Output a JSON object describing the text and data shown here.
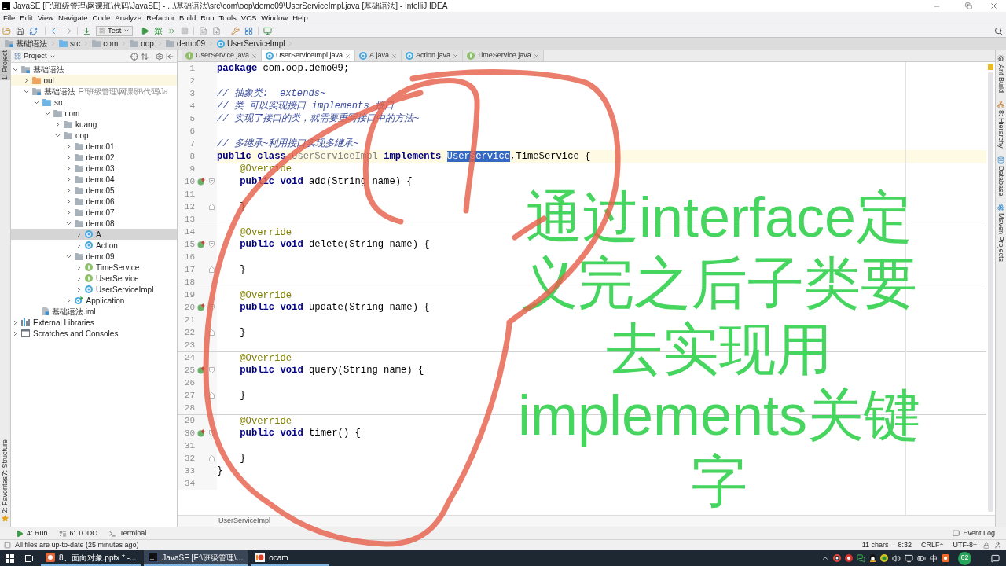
{
  "window": {
    "title": "JavaSE [F:\\班级管理\\网课班\\代码\\JavaSE] - ...\\基础语法\\src\\com\\oop\\demo09\\UserServiceImpl.java [基础语法] - IntelliJ IDEA"
  },
  "menu": [
    "File",
    "Edit",
    "View",
    "Navigate",
    "Code",
    "Analyze",
    "Refactor",
    "Build",
    "Run",
    "Tools",
    "VCS",
    "Window",
    "Help"
  ],
  "toolbar": {
    "run_config": "Test"
  },
  "nav_bar": [
    {
      "label": "基础语法",
      "kind": "module"
    },
    {
      "label": "src",
      "kind": "source-folder"
    },
    {
      "label": "com",
      "kind": "package"
    },
    {
      "label": "oop",
      "kind": "package"
    },
    {
      "label": "demo09",
      "kind": "package"
    },
    {
      "label": "UserServiceImpl",
      "kind": "class"
    }
  ],
  "left_strip": [
    {
      "label": "1: Project",
      "selected": true
    },
    {
      "label": "7: Structure",
      "selected": false
    },
    {
      "label": "2: Favorites",
      "selected": false
    }
  ],
  "project_panel": {
    "title": "Project",
    "tree": [
      {
        "label": "基础语法",
        "kind": "module",
        "expanded": true,
        "selected": false,
        "children": [
          {
            "label": "out",
            "kind": "excluded-folder",
            "expanded": false,
            "selected": false
          },
          {
            "label": "基础语法",
            "path_hint": "F:\\班级管理\\网课班\\代码\\Ja",
            "kind": "module",
            "expanded": true,
            "selected": false,
            "children": [
              {
                "label": "src",
                "kind": "source-folder",
                "expanded": true,
                "selected": false,
                "children": [
                  {
                    "label": "com",
                    "kind": "package",
                    "expanded": true,
                    "selected": false,
                    "children": [
                      {
                        "label": "kuang",
                        "kind": "package",
                        "expanded": false,
                        "selected": false
                      },
                      {
                        "label": "oop",
                        "kind": "package",
                        "expanded": true,
                        "selected": false,
                        "children": [
                          {
                            "label": "demo01",
                            "kind": "package",
                            "expanded": false,
                            "selected": false
                          },
                          {
                            "label": "demo02",
                            "kind": "package",
                            "expanded": false,
                            "selected": false
                          },
                          {
                            "label": "demo03",
                            "kind": "package",
                            "expanded": false,
                            "selected": false
                          },
                          {
                            "label": "demo04",
                            "kind": "package",
                            "expanded": false,
                            "selected": false
                          },
                          {
                            "label": "demo05",
                            "kind": "package",
                            "expanded": false,
                            "selected": false
                          },
                          {
                            "label": "demo06",
                            "kind": "package",
                            "expanded": false,
                            "selected": false
                          },
                          {
                            "label": "demo07",
                            "kind": "package",
                            "expanded": false,
                            "selected": false
                          },
                          {
                            "label": "demo08",
                            "kind": "package",
                            "expanded": true,
                            "selected": false,
                            "children": [
                              {
                                "label": "A",
                                "kind": "class",
                                "expanded": false,
                                "selected": true
                              },
                              {
                                "label": "Action",
                                "kind": "class",
                                "expanded": false,
                                "selected": false
                              }
                            ]
                          },
                          {
                            "label": "demo09",
                            "kind": "package",
                            "expanded": true,
                            "selected": false,
                            "children": [
                              {
                                "label": "TimeService",
                                "kind": "interface",
                                "expanded": false,
                                "selected": false
                              },
                              {
                                "label": "UserService",
                                "kind": "interface",
                                "expanded": false,
                                "selected": false
                              },
                              {
                                "label": "UserServiceImpl",
                                "kind": "class",
                                "expanded": false,
                                "selected": false
                              }
                            ]
                          },
                          {
                            "label": "Application",
                            "kind": "app-class",
                            "expanded": false,
                            "selected": false
                          }
                        ]
                      }
                    ]
                  }
                ]
              },
              {
                "label": "基础语法.iml",
                "kind": "iml",
                "selected": false
              }
            ]
          }
        ]
      },
      {
        "label": "External Libraries",
        "kind": "libraries",
        "expanded": false,
        "selected": false
      },
      {
        "label": "Scratches and Consoles",
        "kind": "scratches",
        "expanded": false,
        "selected": false
      }
    ]
  },
  "editor": {
    "tabs": [
      {
        "label": "UserService.java",
        "kind": "interface",
        "selected": false
      },
      {
        "label": "UserServiceImpl.java",
        "kind": "class",
        "selected": true
      },
      {
        "label": "A.java",
        "kind": "class",
        "selected": false
      },
      {
        "label": "Action.java",
        "kind": "class",
        "selected": false
      },
      {
        "label": "TimeService.java",
        "kind": "interface",
        "selected": false
      }
    ],
    "lines": [
      {
        "n": "1",
        "current": false,
        "separator": false,
        "tokens": [
          {
            "kind": "keyword",
            "text": "package"
          },
          {
            "kind": "plain",
            "text": " com.oop.demo09;"
          }
        ]
      },
      {
        "n": "2",
        "current": false,
        "separator": false
      },
      {
        "n": "3",
        "current": false,
        "separator": false,
        "tokens": [
          {
            "kind": "comment",
            "text": "// 抽象类:  extends~"
          }
        ]
      },
      {
        "n": "4",
        "current": false,
        "separator": false,
        "tokens": [
          {
            "kind": "comment",
            "text": "// 类 可以实现接口 implements 接口"
          }
        ]
      },
      {
        "n": "5",
        "current": false,
        "separator": false,
        "tokens": [
          {
            "kind": "comment",
            "text": "// 实现了接口的类，就需要重写接口中的方法~"
          }
        ]
      },
      {
        "n": "6",
        "current": false,
        "separator": false
      },
      {
        "n": "7",
        "current": false,
        "separator": false,
        "tokens": [
          {
            "kind": "comment",
            "text": "// 多继承~利用接口实现多继承~"
          }
        ]
      },
      {
        "n": "8",
        "current": true,
        "separator": false,
        "tokens": [
          {
            "kind": "keyword",
            "text": "public"
          },
          {
            "kind": "keyword",
            "text": " class"
          },
          {
            "kind": "unused",
            "text": " UserServiceImpl"
          },
          {
            "kind": "keyword",
            "text": " implements "
          },
          {
            "kind": "selection",
            "text": "UserService"
          },
          {
            "kind": "plain",
            "text": ",TimeService {"
          }
        ]
      },
      {
        "n": "9",
        "current": false,
        "separator": false,
        "tokens": [
          {
            "kind": "annotation",
            "text": "    @Override"
          }
        ]
      },
      {
        "n": "10",
        "current": false,
        "separator": false,
        "gutter_icons": [
          {
            "kind": "implements"
          },
          {
            "kind": "fold-start"
          }
        ],
        "tokens": [
          {
            "kind": "keyword",
            "text": "    public"
          },
          {
            "kind": "keyword",
            "text": " void"
          },
          {
            "kind": "plain",
            "text": " add(String name) {"
          }
        ]
      },
      {
        "n": "11",
        "current": false,
        "separator": false
      },
      {
        "n": "12",
        "current": false,
        "separator": false,
        "gutter_icons": [
          {
            "kind": "fold-end"
          }
        ],
        "tokens": [
          {
            "kind": "plain",
            "text": "    }"
          }
        ]
      },
      {
        "n": "13",
        "current": false,
        "separator": false
      },
      {
        "n": "14",
        "current": false,
        "separator": true,
        "tokens": [
          {
            "kind": "annotation",
            "text": "    @Override"
          }
        ]
      },
      {
        "n": "15",
        "current": false,
        "separator": false,
        "gutter_icons": [
          {
            "kind": "implements"
          },
          {
            "kind": "fold-start"
          }
        ],
        "tokens": [
          {
            "kind": "keyword",
            "text": "    public"
          },
          {
            "kind": "keyword",
            "text": " void"
          },
          {
            "kind": "plain",
            "text": " delete(String name) {"
          }
        ]
      },
      {
        "n": "16",
        "current": false,
        "separator": false
      },
      {
        "n": "17",
        "current": false,
        "separator": false,
        "gutter_icons": [
          {
            "kind": "fold-end"
          }
        ],
        "tokens": [
          {
            "kind": "plain",
            "text": "    }"
          }
        ]
      },
      {
        "n": "18",
        "current": false,
        "separator": false
      },
      {
        "n": "19",
        "current": false,
        "separator": true,
        "tokens": [
          {
            "kind": "annotation",
            "text": "    @Override"
          }
        ]
      },
      {
        "n": "20",
        "current": false,
        "separator": false,
        "gutter_icons": [
          {
            "kind": "implements"
          },
          {
            "kind": "fold-start"
          }
        ],
        "tokens": [
          {
            "kind": "keyword",
            "text": "    public"
          },
          {
            "kind": "keyword",
            "text": " void"
          },
          {
            "kind": "plain",
            "text": " update(String name) {"
          }
        ]
      },
      {
        "n": "21",
        "current": false,
        "separator": false
      },
      {
        "n": "22",
        "current": false,
        "separator": false,
        "gutter_icons": [
          {
            "kind": "fold-end"
          }
        ],
        "tokens": [
          {
            "kind": "plain",
            "text": "    }"
          }
        ]
      },
      {
        "n": "23",
        "current": false,
        "separator": false
      },
      {
        "n": "24",
        "current": false,
        "separator": true,
        "tokens": [
          {
            "kind": "annotation",
            "text": "    @Override"
          }
        ]
      },
      {
        "n": "25",
        "current": false,
        "separator": false,
        "gutter_icons": [
          {
            "kind": "implements"
          },
          {
            "kind": "fold-start"
          }
        ],
        "tokens": [
          {
            "kind": "keyword",
            "text": "    public"
          },
          {
            "kind": "keyword",
            "text": " void"
          },
          {
            "kind": "plain",
            "text": " query(String name) {"
          }
        ]
      },
      {
        "n": "26",
        "current": false,
        "separator": false
      },
      {
        "n": "27",
        "current": false,
        "separator": false,
        "gutter_icons": [
          {
            "kind": "fold-end"
          }
        ],
        "tokens": [
          {
            "kind": "plain",
            "text": "    }"
          }
        ]
      },
      {
        "n": "28",
        "current": false,
        "separator": false
      },
      {
        "n": "29",
        "current": false,
        "separator": true,
        "tokens": [
          {
            "kind": "annotation",
            "text": "    @Override"
          }
        ]
      },
      {
        "n": "30",
        "current": false,
        "separator": false,
        "gutter_icons": [
          {
            "kind": "implements"
          },
          {
            "kind": "fold-start"
          }
        ],
        "tokens": [
          {
            "kind": "keyword",
            "text": "    public"
          },
          {
            "kind": "keyword",
            "text": " void"
          },
          {
            "kind": "plain",
            "text": " timer() {"
          }
        ]
      },
      {
        "n": "31",
        "current": false,
        "separator": false
      },
      {
        "n": "32",
        "current": false,
        "separator": false,
        "gutter_icons": [
          {
            "kind": "fold-end"
          }
        ],
        "tokens": [
          {
            "kind": "plain",
            "text": "    }"
          }
        ]
      },
      {
        "n": "33",
        "current": false,
        "separator": false,
        "tokens": [
          {
            "kind": "plain",
            "text": "}"
          }
        ]
      },
      {
        "n": "34",
        "current": false,
        "separator": false
      }
    ],
    "breadcrumb": "UserServiceImpl"
  },
  "caption": {
    "lines": [
      "通过interface定",
      "义完之后子类要",
      "去实现用",
      "implements关键",
      "字"
    ]
  },
  "right_strip": [
    {
      "label": "Ant Build",
      "kind": "ant"
    },
    {
      "label": "8: Hierarchy",
      "kind": "hierarchy"
    },
    {
      "label": "Database",
      "kind": "database"
    },
    {
      "label": "Maven Projects",
      "kind": "maven"
    }
  ],
  "tool_windows": [
    {
      "label": "4: Run",
      "kind": "run"
    },
    {
      "label": "6: TODO",
      "kind": "todo"
    },
    {
      "label": "Terminal",
      "kind": "terminal"
    }
  ],
  "event_log": "Event Log",
  "status_bar": {
    "message": "All files are up-to-date (25 minutes ago)",
    "items": [
      "11 chars",
      "8:32",
      "CRLF÷",
      "UTF-8÷"
    ]
  },
  "taskbar": {
    "apps": [
      {
        "label": "8、面向对象.pptx * -...",
        "kind": "presentation",
        "selected": false
      },
      {
        "label": "JavaSE [F:\\班级管理\\...",
        "kind": "ide",
        "selected": true
      },
      {
        "label": "ocam",
        "kind": "recorder",
        "selected": false
      }
    ],
    "ime": "中",
    "badge": "62"
  }
}
